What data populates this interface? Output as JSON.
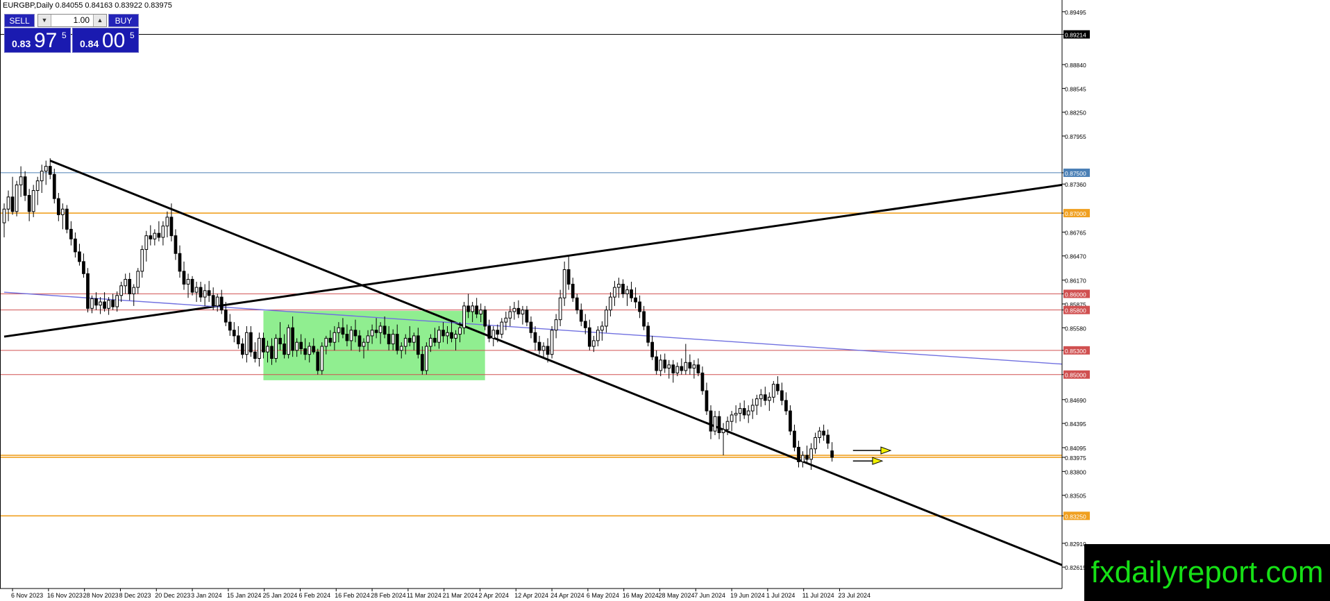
{
  "header": {
    "symbol_line": "EURGBP,Daily  0.84055 0.84163 0.83922 0.83975"
  },
  "trade_panel": {
    "sell_label": "SELL",
    "buy_label": "BUY",
    "lot_value": "1.00",
    "sell_prefix": "0.83",
    "sell_big": "97",
    "sell_sup": "5",
    "buy_prefix": "0.84",
    "buy_big": "00",
    "buy_sup": "5"
  },
  "watermark": "fxdailyreport.com",
  "colors": {
    "up_candle": "#ffffff",
    "down_candle": "#000000",
    "green_zone": "#90ee90",
    "blue_level": "#4a7fb5",
    "orange_level": "#f0a020",
    "red_level": "#d05050",
    "ma_line": "#7070e0",
    "arrow_yellow": "#f0f000",
    "trade_blue": "#2323b8",
    "watermark_text": "#16e016"
  },
  "chart_data": {
    "type": "candlestick",
    "symbol": "EURGBP",
    "timeframe": "Daily",
    "ohlc_current": {
      "open": 0.84055,
      "high": 0.84163,
      "low": 0.83922,
      "close": 0.83975
    },
    "y_range": [
      0.8235,
      0.8964
    ],
    "y_ticks": [
      "0.89495",
      "0.89214",
      "0.88840",
      "0.88545",
      "0.88250",
      "0.87955",
      "0.87500",
      "0.87360",
      "0.87000",
      "0.86765",
      "0.86470",
      "0.86170",
      "0.86000",
      "0.85875",
      "0.85800",
      "0.85580",
      "0.85300",
      "0.85000",
      "0.84690",
      "0.84395",
      "0.84095",
      "0.83975",
      "0.83800",
      "0.83505",
      "0.83250",
      "0.82910",
      "0.82615"
    ],
    "x_ticks": [
      "6 Nov 2023",
      "16 Nov 2023",
      "28 Nov 2023",
      "8 Dec 2023",
      "20 Dec 2023",
      "3 Jan 2024",
      "15 Jan 2024",
      "25 Jan 2024",
      "6 Feb 2024",
      "16 Feb 2024",
      "28 Feb 2024",
      "11 Mar 2024",
      "21 Mar 2024",
      "2 Apr 2024",
      "12 Apr 2024",
      "24 Apr 2024",
      "6 May 2024",
      "16 May 2024",
      "28 May 2024",
      "7 Jun 2024",
      "19 Jun 2024",
      "1 Jul 2024",
      "11 Jul 2024",
      "23 Jul 2024"
    ],
    "price_tags": [
      {
        "price": "0.89214",
        "color": "#000000"
      },
      {
        "price": "0.87500",
        "color": "#4a7fb5"
      },
      {
        "price": "0.87000",
        "color": "#f0a020"
      },
      {
        "price": "0.86000",
        "color": "#d05050"
      },
      {
        "price": "0.85800",
        "color": "#d05050"
      },
      {
        "price": "0.85300",
        "color": "#d05050"
      },
      {
        "price": "0.85000",
        "color": "#d05050"
      },
      {
        "price": "0.84000",
        "color": "#f0a020"
      },
      {
        "price": "0.83250",
        "color": "#f0a020"
      }
    ],
    "horizontal_levels": [
      {
        "price": 0.89214,
        "color": "#000000"
      },
      {
        "price": 0.875,
        "color": "#4a7fb5"
      },
      {
        "price": 0.87,
        "color": "#f0a020"
      },
      {
        "price": 0.86,
        "color": "#d05050"
      },
      {
        "price": 0.858,
        "color": "#d05050"
      },
      {
        "price": 0.853,
        "color": "#d05050"
      },
      {
        "price": 0.85,
        "color": "#d05050"
      },
      {
        "price": 0.84,
        "color": "#f0a020"
      },
      {
        "price": 0.83975,
        "color": "#f0a020"
      },
      {
        "price": 0.8325,
        "color": "#f0a020"
      }
    ],
    "trendlines": [
      {
        "from": {
          "bar": 0,
          "price": 0.8547
        },
        "to": {
          "bar": 253,
          "price": 0.8735
        },
        "color": "#000000"
      },
      {
        "from": {
          "bar": 11,
          "price": 0.8765
        },
        "to": {
          "bar": 253,
          "price": 0.8264
        },
        "color": "#000000"
      },
      {
        "from": {
          "bar": 0,
          "price": 0.8602
        },
        "to": {
          "bar": 253,
          "price": 0.8513
        },
        "color": "#7070e0"
      }
    ],
    "zone": {
      "bar_from": 62,
      "bar_to": 115,
      "price_from": 0.8493,
      "price_to": 0.8579
    },
    "arrows": [
      {
        "bar_from": 203,
        "bar_to": 212,
        "price": 0.8406
      },
      {
        "bar_from": 203,
        "bar_to": 210,
        "price": 0.8393
      }
    ],
    "candles": [
      [
        0.8688,
        0.8712,
        0.867,
        0.8705
      ],
      [
        0.8705,
        0.8728,
        0.869,
        0.872
      ],
      [
        0.872,
        0.8745,
        0.8698,
        0.8702
      ],
      [
        0.8702,
        0.874,
        0.8696,
        0.8735
      ],
      [
        0.8735,
        0.8758,
        0.872,
        0.8745
      ],
      [
        0.8745,
        0.8752,
        0.8715,
        0.8722
      ],
      [
        0.8722,
        0.873,
        0.869,
        0.8702
      ],
      [
        0.8702,
        0.8735,
        0.8695,
        0.8728
      ],
      [
        0.8728,
        0.8745,
        0.871,
        0.874
      ],
      [
        0.874,
        0.876,
        0.8725,
        0.8752
      ],
      [
        0.8752,
        0.8765,
        0.8735,
        0.8758
      ],
      [
        0.8758,
        0.8768,
        0.8742,
        0.8748
      ],
      [
        0.8748,
        0.8755,
        0.8712,
        0.8718
      ],
      [
        0.8718,
        0.8725,
        0.869,
        0.8698
      ],
      [
        0.8698,
        0.8712,
        0.868,
        0.8705
      ],
      [
        0.8705,
        0.871,
        0.8675,
        0.868
      ],
      [
        0.868,
        0.869,
        0.866,
        0.8668
      ],
      [
        0.8668,
        0.8676,
        0.8645,
        0.8652
      ],
      [
        0.8652,
        0.8662,
        0.8635,
        0.864
      ],
      [
        0.864,
        0.865,
        0.862,
        0.8625
      ],
      [
        0.8625,
        0.8632,
        0.8577,
        0.8582
      ],
      [
        0.8582,
        0.8598,
        0.8576,
        0.8594
      ],
      [
        0.8594,
        0.8602,
        0.858,
        0.8586
      ],
      [
        0.8586,
        0.8596,
        0.8575,
        0.859
      ],
      [
        0.859,
        0.8602,
        0.8578,
        0.8582
      ],
      [
        0.8582,
        0.8596,
        0.8574,
        0.8592
      ],
      [
        0.8592,
        0.86,
        0.858,
        0.8584
      ],
      [
        0.8584,
        0.8603,
        0.8578,
        0.8598
      ],
      [
        0.8598,
        0.8615,
        0.859,
        0.861
      ],
      [
        0.861,
        0.8625,
        0.86,
        0.8618
      ],
      [
        0.8618,
        0.8626,
        0.8592,
        0.86
      ],
      [
        0.86,
        0.8612,
        0.8585,
        0.8608
      ],
      [
        0.8608,
        0.8632,
        0.86,
        0.8628
      ],
      [
        0.8628,
        0.866,
        0.862,
        0.8655
      ],
      [
        0.8655,
        0.8678,
        0.864,
        0.8672
      ],
      [
        0.8672,
        0.8685,
        0.866,
        0.8668
      ],
      [
        0.8668,
        0.868,
        0.866,
        0.8675
      ],
      [
        0.8675,
        0.869,
        0.8665,
        0.867
      ],
      [
        0.867,
        0.869,
        0.866,
        0.8684
      ],
      [
        0.8684,
        0.8702,
        0.867,
        0.8695
      ],
      [
        0.8695,
        0.8712,
        0.8665,
        0.8672
      ],
      [
        0.8672,
        0.868,
        0.8642,
        0.865
      ],
      [
        0.865,
        0.866,
        0.862,
        0.8628
      ],
      [
        0.8628,
        0.864,
        0.8605,
        0.8612
      ],
      [
        0.8612,
        0.8625,
        0.8595,
        0.8618
      ],
      [
        0.8618,
        0.8622,
        0.8598,
        0.8602
      ],
      [
        0.8602,
        0.8615,
        0.859,
        0.8608
      ],
      [
        0.8608,
        0.8615,
        0.859,
        0.8596
      ],
      [
        0.8596,
        0.8612,
        0.8585,
        0.8604
      ],
      [
        0.8604,
        0.8616,
        0.859,
        0.8598
      ],
      [
        0.8598,
        0.8608,
        0.858,
        0.8585
      ],
      [
        0.8585,
        0.86,
        0.8578,
        0.8596
      ],
      [
        0.8596,
        0.8605,
        0.8575,
        0.858
      ],
      [
        0.858,
        0.859,
        0.856,
        0.8565
      ],
      [
        0.8565,
        0.8575,
        0.8548,
        0.8555
      ],
      [
        0.8555,
        0.8565,
        0.854,
        0.8548
      ],
      [
        0.8548,
        0.856,
        0.8532,
        0.8538
      ],
      [
        0.8538,
        0.8545,
        0.852,
        0.8525
      ],
      [
        0.8525,
        0.856,
        0.8515,
        0.8552
      ],
      [
        0.8552,
        0.856,
        0.8522,
        0.8528
      ],
      [
        0.8528,
        0.854,
        0.8515,
        0.852
      ],
      [
        0.852,
        0.8552,
        0.851,
        0.8545
      ],
      [
        0.8545,
        0.8552,
        0.852,
        0.8528
      ],
      [
        0.8528,
        0.8542,
        0.8515,
        0.8535
      ],
      [
        0.8535,
        0.8545,
        0.8512,
        0.852
      ],
      [
        0.852,
        0.855,
        0.8515,
        0.8545
      ],
      [
        0.8545,
        0.8565,
        0.853,
        0.8538
      ],
      [
        0.8538,
        0.855,
        0.852,
        0.8525
      ],
      [
        0.8525,
        0.8562,
        0.852,
        0.8558
      ],
      [
        0.8558,
        0.8572,
        0.8522,
        0.853
      ],
      [
        0.853,
        0.8545,
        0.8522,
        0.854
      ],
      [
        0.854,
        0.855,
        0.8525,
        0.8532
      ],
      [
        0.8532,
        0.8545,
        0.8518,
        0.8525
      ],
      [
        0.8525,
        0.854,
        0.8515,
        0.8535
      ],
      [
        0.8535,
        0.8545,
        0.8525,
        0.8528
      ],
      [
        0.8528,
        0.8532,
        0.85,
        0.8505
      ],
      [
        0.8505,
        0.854,
        0.85,
        0.8535
      ],
      [
        0.8535,
        0.8548,
        0.8525,
        0.8545
      ],
      [
        0.8545,
        0.8555,
        0.8535,
        0.854
      ],
      [
        0.854,
        0.856,
        0.853,
        0.8552
      ],
      [
        0.8552,
        0.8565,
        0.854,
        0.8558
      ],
      [
        0.8558,
        0.857,
        0.8545,
        0.855
      ],
      [
        0.855,
        0.8562,
        0.8535,
        0.8542
      ],
      [
        0.8542,
        0.856,
        0.853,
        0.8555
      ],
      [
        0.8555,
        0.8568,
        0.854,
        0.8548
      ],
      [
        0.8548,
        0.8555,
        0.8528,
        0.8535
      ],
      [
        0.8535,
        0.8545,
        0.852,
        0.854
      ],
      [
        0.854,
        0.8555,
        0.853,
        0.8548
      ],
      [
        0.8548,
        0.8562,
        0.8538,
        0.8555
      ],
      [
        0.8555,
        0.857,
        0.8545,
        0.8552
      ],
      [
        0.8552,
        0.8565,
        0.8538,
        0.856
      ],
      [
        0.856,
        0.8572,
        0.8545,
        0.855
      ],
      [
        0.855,
        0.856,
        0.853,
        0.8538
      ],
      [
        0.8538,
        0.8556,
        0.853,
        0.855
      ],
      [
        0.855,
        0.8562,
        0.8525,
        0.853
      ],
      [
        0.853,
        0.854,
        0.852,
        0.8535
      ],
      [
        0.8535,
        0.855,
        0.8525,
        0.8545
      ],
      [
        0.8545,
        0.856,
        0.8535,
        0.854
      ],
      [
        0.854,
        0.8552,
        0.853,
        0.8548
      ],
      [
        0.8548,
        0.8558,
        0.852,
        0.8525
      ],
      [
        0.8525,
        0.8535,
        0.85,
        0.8505
      ],
      [
        0.8505,
        0.854,
        0.85,
        0.8535
      ],
      [
        0.8535,
        0.855,
        0.8528,
        0.8545
      ],
      [
        0.8545,
        0.8558,
        0.8535,
        0.854
      ],
      [
        0.854,
        0.856,
        0.8532,
        0.8555
      ],
      [
        0.8555,
        0.8565,
        0.854,
        0.8548
      ],
      [
        0.8548,
        0.856,
        0.8538,
        0.8552
      ],
      [
        0.8552,
        0.8565,
        0.854,
        0.8545
      ],
      [
        0.8545,
        0.8555,
        0.853,
        0.855
      ],
      [
        0.855,
        0.8565,
        0.854,
        0.8558
      ],
      [
        0.8558,
        0.859,
        0.855,
        0.8585
      ],
      [
        0.8585,
        0.86,
        0.857,
        0.8578
      ],
      [
        0.8578,
        0.859,
        0.8565,
        0.8585
      ],
      [
        0.8585,
        0.8595,
        0.857,
        0.8575
      ],
      [
        0.8575,
        0.8588,
        0.8565,
        0.858
      ],
      [
        0.858,
        0.8585,
        0.8555,
        0.856
      ],
      [
        0.856,
        0.8568,
        0.854,
        0.8545
      ],
      [
        0.8545,
        0.856,
        0.8535,
        0.8555
      ],
      [
        0.8555,
        0.8562,
        0.854,
        0.855
      ],
      [
        0.855,
        0.857,
        0.8545,
        0.8565
      ],
      [
        0.8565,
        0.8578,
        0.8555,
        0.857
      ],
      [
        0.857,
        0.8585,
        0.856,
        0.8578
      ],
      [
        0.8578,
        0.859,
        0.8568,
        0.8582
      ],
      [
        0.8582,
        0.8592,
        0.857,
        0.8575
      ],
      [
        0.8575,
        0.8585,
        0.8562,
        0.858
      ],
      [
        0.858,
        0.8585,
        0.856,
        0.8565
      ],
      [
        0.8565,
        0.8572,
        0.8545,
        0.8552
      ],
      [
        0.8552,
        0.856,
        0.853,
        0.854
      ],
      [
        0.854,
        0.8548,
        0.8525,
        0.853
      ],
      [
        0.853,
        0.854,
        0.852,
        0.8535
      ],
      [
        0.8535,
        0.8545,
        0.8515,
        0.8525
      ],
      [
        0.8525,
        0.856,
        0.852,
        0.8555
      ],
      [
        0.8555,
        0.8575,
        0.8545,
        0.8568
      ],
      [
        0.8568,
        0.8605,
        0.856,
        0.8595
      ],
      [
        0.8595,
        0.864,
        0.8585,
        0.863
      ],
      [
        0.863,
        0.8648,
        0.8605,
        0.8612
      ],
      [
        0.8612,
        0.862,
        0.859,
        0.8595
      ],
      [
        0.8595,
        0.86,
        0.8575,
        0.858
      ],
      [
        0.858,
        0.8588,
        0.856,
        0.8566
      ],
      [
        0.8566,
        0.8575,
        0.855,
        0.8558
      ],
      [
        0.8558,
        0.8568,
        0.853,
        0.8535
      ],
      [
        0.8535,
        0.8548,
        0.8528,
        0.8542
      ],
      [
        0.8542,
        0.856,
        0.8535,
        0.8555
      ],
      [
        0.8555,
        0.8566,
        0.8542,
        0.856
      ],
      [
        0.856,
        0.8585,
        0.8552,
        0.858
      ],
      [
        0.858,
        0.8602,
        0.8572,
        0.8596
      ],
      [
        0.8596,
        0.8616,
        0.8585,
        0.8608
      ],
      [
        0.8608,
        0.862,
        0.8595,
        0.8612
      ],
      [
        0.8612,
        0.8618,
        0.8595,
        0.86
      ],
      [
        0.86,
        0.861,
        0.8585,
        0.8605
      ],
      [
        0.8605,
        0.8615,
        0.859,
        0.8595
      ],
      [
        0.8595,
        0.8608,
        0.8582,
        0.859
      ],
      [
        0.859,
        0.8598,
        0.857,
        0.8578
      ],
      [
        0.8578,
        0.8585,
        0.8555,
        0.856
      ],
      [
        0.856,
        0.8565,
        0.8535,
        0.854
      ],
      [
        0.854,
        0.8548,
        0.8518,
        0.8522
      ],
      [
        0.8522,
        0.853,
        0.85,
        0.8505
      ],
      [
        0.8505,
        0.8525,
        0.8498,
        0.8518
      ],
      [
        0.8518,
        0.8526,
        0.8502,
        0.8508
      ],
      [
        0.8508,
        0.8518,
        0.8495,
        0.8512
      ],
      [
        0.8512,
        0.8518,
        0.849,
        0.8502
      ],
      [
        0.8502,
        0.8515,
        0.8498,
        0.851
      ],
      [
        0.851,
        0.852,
        0.85,
        0.8505
      ],
      [
        0.8505,
        0.8538,
        0.85,
        0.8515
      ],
      [
        0.8515,
        0.8525,
        0.85,
        0.8508
      ],
      [
        0.8508,
        0.8518,
        0.8495,
        0.8512
      ],
      [
        0.8512,
        0.852,
        0.8498,
        0.8502
      ],
      [
        0.8502,
        0.851,
        0.8475,
        0.848
      ],
      [
        0.848,
        0.849,
        0.845,
        0.8455
      ],
      [
        0.8455,
        0.8462,
        0.842,
        0.843
      ],
      [
        0.843,
        0.8455,
        0.8425,
        0.8448
      ],
      [
        0.8448,
        0.8455,
        0.842,
        0.8428
      ],
      [
        0.8428,
        0.844,
        0.84,
        0.8432
      ],
      [
        0.8432,
        0.8448,
        0.8425,
        0.8442
      ],
      [
        0.8442,
        0.8455,
        0.843,
        0.845
      ],
      [
        0.845,
        0.8462,
        0.844,
        0.8452
      ],
      [
        0.8452,
        0.8465,
        0.8442,
        0.8458
      ],
      [
        0.8458,
        0.8468,
        0.8445,
        0.845
      ],
      [
        0.845,
        0.8462,
        0.844,
        0.8455
      ],
      [
        0.8455,
        0.847,
        0.8445,
        0.8462
      ],
      [
        0.8462,
        0.8475,
        0.845,
        0.847
      ],
      [
        0.847,
        0.8482,
        0.846,
        0.8475
      ],
      [
        0.8475,
        0.8485,
        0.8462,
        0.8468
      ],
      [
        0.8468,
        0.8478,
        0.8455,
        0.8472
      ],
      [
        0.8472,
        0.8492,
        0.8465,
        0.8488
      ],
      [
        0.8488,
        0.8498,
        0.8475,
        0.848
      ],
      [
        0.848,
        0.849,
        0.8462,
        0.8468
      ],
      [
        0.8468,
        0.8478,
        0.845,
        0.8455
      ],
      [
        0.8455,
        0.8462,
        0.8425,
        0.843
      ],
      [
        0.843,
        0.8438,
        0.8405,
        0.841
      ],
      [
        0.841,
        0.8418,
        0.8385,
        0.8392
      ],
      [
        0.8392,
        0.8405,
        0.8385,
        0.84
      ],
      [
        0.84,
        0.8412,
        0.839,
        0.8395
      ],
      [
        0.8395,
        0.8415,
        0.8382,
        0.8408
      ],
      [
        0.8408,
        0.8428,
        0.8402,
        0.8422
      ],
      [
        0.8422,
        0.8435,
        0.8415,
        0.843
      ],
      [
        0.843,
        0.8438,
        0.8418,
        0.8425
      ],
      [
        0.8425,
        0.8432,
        0.8408,
        0.8415
      ],
      [
        0.84055,
        0.84163,
        0.83922,
        0.83975
      ]
    ]
  }
}
